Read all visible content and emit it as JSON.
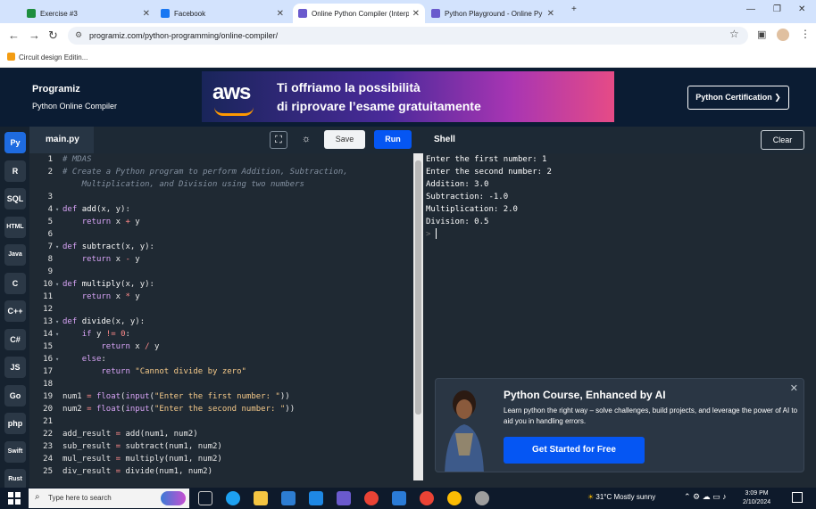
{
  "browser": {
    "tabs": [
      {
        "title": "Exercise #3",
        "active": false,
        "favicon_color": "#1e8e3e"
      },
      {
        "title": "Facebook",
        "active": false,
        "favicon_color": "#1877f2"
      },
      {
        "title": "Online Python Compiler (Interp",
        "active": true,
        "favicon_color": "#6a5acd"
      },
      {
        "title": "Python Playground - Online Py",
        "active": false,
        "favicon_color": "#6a5acd"
      }
    ],
    "url": "programiz.com/python-programming/online-compiler/",
    "bookmark": "Circuit design Editin..."
  },
  "site": {
    "logo": "Programiz",
    "subtitle": "Python Online Compiler",
    "ad": {
      "brand": "aws",
      "line1": "Ti offriamo la possibilità",
      "line2": "di riprovare l’esame gratuitamente"
    },
    "cert_button": "Python Certification ❯"
  },
  "rail": [
    "Py",
    "R",
    "SQL",
    "HTML",
    "Java",
    "C",
    "C++",
    "C#",
    "JS",
    "Go",
    "php",
    "Swift",
    "Rust"
  ],
  "editor": {
    "filename": "main.py",
    "save_label": "Save",
    "run_label": "Run",
    "lines": [
      {
        "n": "1",
        "fold": false,
        "html": "<span class='cm'># MDAS</span>"
      },
      {
        "n": "2",
        "fold": false,
        "html": "<span class='cm'># Create a Python program to perform Addition, Subtraction,</span>"
      },
      {
        "n": "",
        "fold": false,
        "html": "<span class='cm'>    Multiplication, and Division using two numbers</span>"
      },
      {
        "n": "3",
        "fold": false,
        "html": ""
      },
      {
        "n": "4",
        "fold": true,
        "html": "<span class='kw'>def</span> <span class='fn'>add</span>(x, y):"
      },
      {
        "n": "5",
        "fold": false,
        "html": "    <span class='kw'>return</span> x <span class='op'>+</span> y"
      },
      {
        "n": "6",
        "fold": false,
        "html": ""
      },
      {
        "n": "7",
        "fold": true,
        "html": "<span class='kw'>def</span> <span class='fn'>subtract</span>(x, y):"
      },
      {
        "n": "8",
        "fold": false,
        "html": "    <span class='kw'>return</span> x <span class='op'>-</span> y"
      },
      {
        "n": "9",
        "fold": false,
        "html": ""
      },
      {
        "n": "10",
        "fold": true,
        "html": "<span class='kw'>def</span> <span class='fn'>multiply</span>(x, y):"
      },
      {
        "n": "11",
        "fold": false,
        "html": "    <span class='kw'>return</span> x <span class='op'>*</span> y"
      },
      {
        "n": "12",
        "fold": false,
        "html": ""
      },
      {
        "n": "13",
        "fold": true,
        "html": "<span class='kw'>def</span> <span class='fn'>divide</span>(x, y):"
      },
      {
        "n": "14",
        "fold": true,
        "html": "    <span class='kw'>if</span> y <span class='op'>!=</span> <span class='nm'>0</span>:"
      },
      {
        "n": "15",
        "fold": false,
        "html": "        <span class='kw'>return</span> x <span class='op'>/</span> y"
      },
      {
        "n": "16",
        "fold": true,
        "html": "    <span class='kw'>else</span>:"
      },
      {
        "n": "17",
        "fold": false,
        "html": "        <span class='kw'>return</span> <span class='st'>\"Cannot divide by zero\"</span>"
      },
      {
        "n": "18",
        "fold": false,
        "html": ""
      },
      {
        "n": "19",
        "fold": false,
        "html": "num1 <span class='op'>=</span> <span class='kw'>float</span>(<span class='kw'>input</span>(<span class='st'>\"Enter the first number: \"</span>))"
      },
      {
        "n": "20",
        "fold": false,
        "html": "num2 <span class='op'>=</span> <span class='kw'>float</span>(<span class='kw'>input</span>(<span class='st'>\"Enter the second number: \"</span>))"
      },
      {
        "n": "21",
        "fold": false,
        "html": ""
      },
      {
        "n": "22",
        "fold": false,
        "html": "add_result <span class='op'>=</span> add(num1, num2)"
      },
      {
        "n": "23",
        "fold": false,
        "html": "sub_result <span class='op'>=</span> subtract(num1, num2)"
      },
      {
        "n": "24",
        "fold": false,
        "html": "mul_result <span class='op'>=</span> multiply(num1, num2)"
      },
      {
        "n": "25",
        "fold": false,
        "html": "div_result <span class='op'>=</span> divide(num1, num2)"
      }
    ]
  },
  "shell": {
    "title": "Shell",
    "clear_label": "Clear",
    "output": [
      "Enter the first number: 1",
      "Enter the second number: 2",
      "Addition: 3.0",
      "Subtraction: -1.0",
      "Multiplication: 2.0",
      "Division: 0.5"
    ],
    "prompt": ">"
  },
  "promo": {
    "title": "Python Course, Enhanced by AI",
    "text": "Learn python the right way – solve challenges, build projects, and leverage the power of AI to aid you in handling errors.",
    "button": "Get Started for Free",
    "close": "✕"
  },
  "taskbar": {
    "search_placeholder": "Type here to search",
    "weather": "31°C  Mostly sunny",
    "time": "3:09 PM",
    "date": "2/10/2024"
  }
}
